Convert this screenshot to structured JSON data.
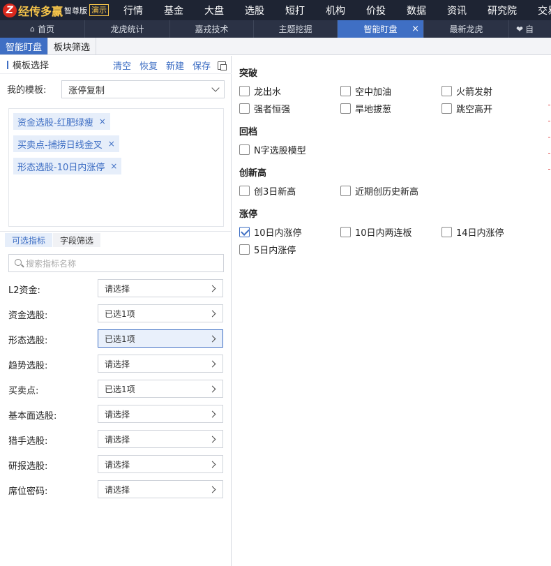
{
  "app": {
    "logo_glyph": "Z",
    "brand": "经传多赢",
    "edition": "智尊版",
    "demo_badge": "演示"
  },
  "topnav": [
    "行情",
    "基金",
    "大盘",
    "选股",
    "短打",
    "机构",
    "价投",
    "数据",
    "资讯",
    "研究院",
    "交易"
  ],
  "tabs": {
    "home": "首页",
    "items": [
      "龙虎统计",
      "嘉戎技术",
      "主题挖掘",
      "智能盯盘",
      "最新龙虎"
    ],
    "active": "智能盯盘",
    "close_glyph": "×",
    "last_partial": "自"
  },
  "subtabs": [
    "智能盯盘",
    "板块筛选"
  ],
  "template": {
    "title": "模板选择",
    "actions": [
      "清空",
      "恢复",
      "新建",
      "保存"
    ],
    "my_template_label": "我的模板:",
    "my_template_value": "涨停复制",
    "tags": [
      "资金选股-红肥绿瘦",
      "买卖点-捕捞日线金叉",
      "形态选股-10日内涨停"
    ],
    "tag_close": "×"
  },
  "indicator_tabs": [
    "可选指标",
    "字段筛选"
  ],
  "search_placeholder": "搜索指标名称",
  "filters": [
    {
      "label": "L2资金:",
      "value": "请选择"
    },
    {
      "label": "资金选股:",
      "value": "已选1项"
    },
    {
      "label": "形态选股:",
      "value": "已选1项"
    },
    {
      "label": "趋势选股:",
      "value": "请选择"
    },
    {
      "label": "买卖点:",
      "value": "已选1项"
    },
    {
      "label": "基本面选股:",
      "value": "请选择"
    },
    {
      "label": "猎手选股:",
      "value": "请选择"
    },
    {
      "label": "研报选股:",
      "value": "请选择"
    },
    {
      "label": "席位密码:",
      "value": "请选择"
    }
  ],
  "groups": [
    {
      "title": "突破",
      "options": [
        {
          "label": "龙出水",
          "checked": false
        },
        {
          "label": "空中加油",
          "checked": false
        },
        {
          "label": "火箭发射",
          "checked": false
        },
        {
          "label": "强者恒强",
          "checked": false
        },
        {
          "label": "旱地拔葱",
          "checked": false
        },
        {
          "label": "跳空高开",
          "checked": false
        }
      ]
    },
    {
      "title": "回档",
      "options": [
        {
          "label": "N字选股模型",
          "checked": false
        }
      ]
    },
    {
      "title": "创新高",
      "options": [
        {
          "label": "创3日新高",
          "checked": false
        },
        {
          "label": "近期创历史新高",
          "checked": false
        }
      ]
    },
    {
      "title": "涨停",
      "options": [
        {
          "label": "10日内涨停",
          "checked": true
        },
        {
          "label": "10日内两连板",
          "checked": false
        },
        {
          "label": "14日内涨停",
          "checked": false
        },
        {
          "label": "5日内涨停",
          "checked": false
        }
      ]
    }
  ]
}
